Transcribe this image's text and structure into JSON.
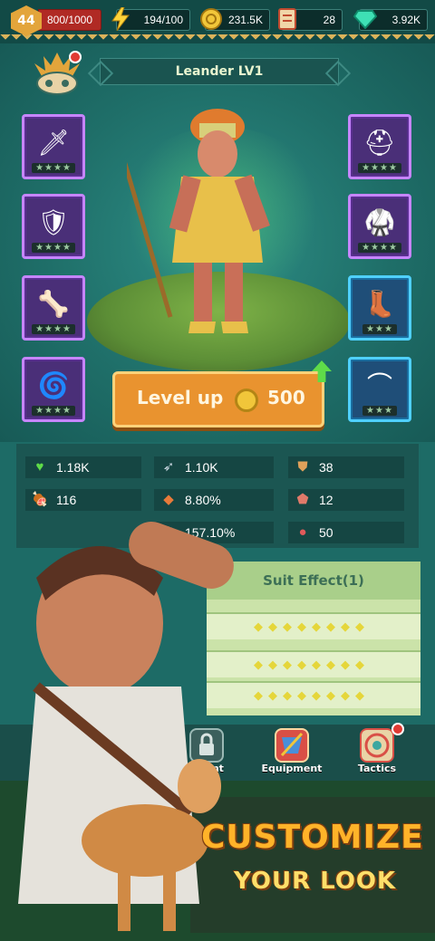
{
  "topbar": {
    "player_level": "44",
    "hp": "800/1000",
    "energy": "194/100",
    "gold": "231.5K",
    "tickets": "28",
    "gems": "3.92K"
  },
  "hero": {
    "name": "Leander  LV1"
  },
  "equipment_left": [
    {
      "icon": "spear-tip-icon",
      "stars": "★★★★"
    },
    {
      "icon": "pauldron-icon",
      "stars": "★★★★"
    },
    {
      "icon": "bracer-icon",
      "stars": "★★★★"
    },
    {
      "icon": "amulet-icon",
      "stars": "★★★★"
    }
  ],
  "equipment_right": [
    {
      "icon": "helmet-icon",
      "stars": "★★★★"
    },
    {
      "icon": "armor-icon",
      "stars": "★★★★"
    },
    {
      "icon": "boots-icon",
      "stars": "★★★"
    },
    {
      "icon": "claw-necklace-icon",
      "stars": "★★★"
    }
  ],
  "level_up": {
    "label": "Level up",
    "cost": "500"
  },
  "stats": {
    "health": "1.18K",
    "attack": "1.10K",
    "defense": "38",
    "regen": "116",
    "crit_rate": "8.80%",
    "dodge": "12",
    "crit_damage": "157.10%",
    "lifesteal": "50"
  },
  "suit": {
    "title": "Suit Effect(1)",
    "rows": [
      "◆◆◆◆◆◆◆◆",
      "◆◆◆◆◆◆◆◆",
      "◆◆◆◆◆◆◆◆"
    ]
  },
  "nav": {
    "talent": "Talent",
    "equipment": "Equipment",
    "tactics": "Tactics"
  },
  "banner": {
    "line1": "CUSTOMIZE",
    "line2": "YOUR LOOK"
  },
  "colors": {
    "background": "#1d6b66",
    "accent_orange": "#e9932f",
    "purple_slot": "#c685ff",
    "blue_slot": "#4fd0ff",
    "gold_text": "#ffb329"
  }
}
